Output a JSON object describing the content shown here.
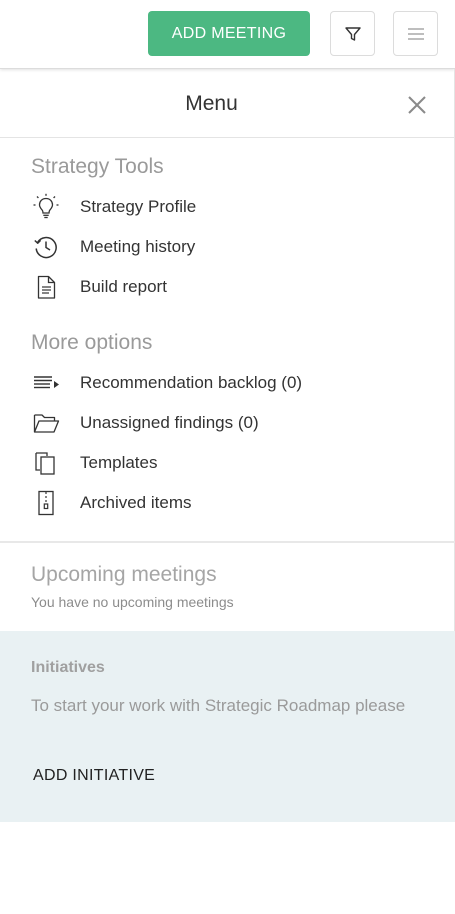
{
  "topbar": {
    "add_meeting_label": "ADD MEETING",
    "accent_color": "#4cb882",
    "filter_icon": "filter-icon",
    "menu_icon": "hamburger-icon"
  },
  "menu": {
    "title": "Menu",
    "close_icon": "close-icon"
  },
  "strategy_tools": {
    "title": "Strategy Tools",
    "items": [
      {
        "label": "Strategy Profile",
        "icon": "lightbulb-icon"
      },
      {
        "label": "Meeting history",
        "icon": "history-icon"
      },
      {
        "label": "Build report",
        "icon": "document-icon"
      }
    ]
  },
  "more_options": {
    "title": "More options",
    "items": [
      {
        "label": "Recommendation backlog (0)",
        "icon": "list-arrow-icon"
      },
      {
        "label": "Unassigned findings (0)",
        "icon": "folder-open-icon"
      },
      {
        "label": "Templates",
        "icon": "copy-icon"
      },
      {
        "label": "Archived items",
        "icon": "archive-icon"
      }
    ]
  },
  "upcoming": {
    "title": "Upcoming meetings",
    "note": "You have no upcoming meetings"
  },
  "initiatives": {
    "title": "Initiatives",
    "text": "To start your work with Strategic Roadmap please",
    "add_label": "ADD INITIATIVE",
    "background": "#e9f1f3"
  }
}
